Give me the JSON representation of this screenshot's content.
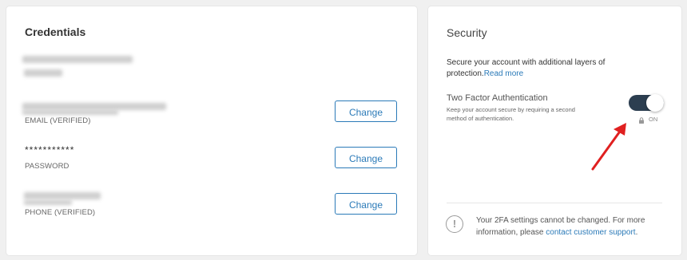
{
  "credentials": {
    "title": "Credentials",
    "email_label": "EMAIL (VERIFIED)",
    "password_value": "***********",
    "password_label": "PASSWORD",
    "phone_label": "PHONE (VERIFIED)",
    "change_label": "Change"
  },
  "security": {
    "title": "Security",
    "description": "Secure your account with additional layers of protection.",
    "read_more": "Read more",
    "tfa_title": "Two Factor Authentication",
    "tfa_help": "Keep your account secure by requiring a second method of authentication.",
    "tfa_state": "ON",
    "info_prefix": "Your 2FA settings cannot be changed. For more information, please ",
    "info_link": "contact customer support",
    "info_suffix": "."
  },
  "colors": {
    "accent": "#2b7ab8",
    "toggle_on": "#2c3e50",
    "arrow": "#e02020"
  }
}
